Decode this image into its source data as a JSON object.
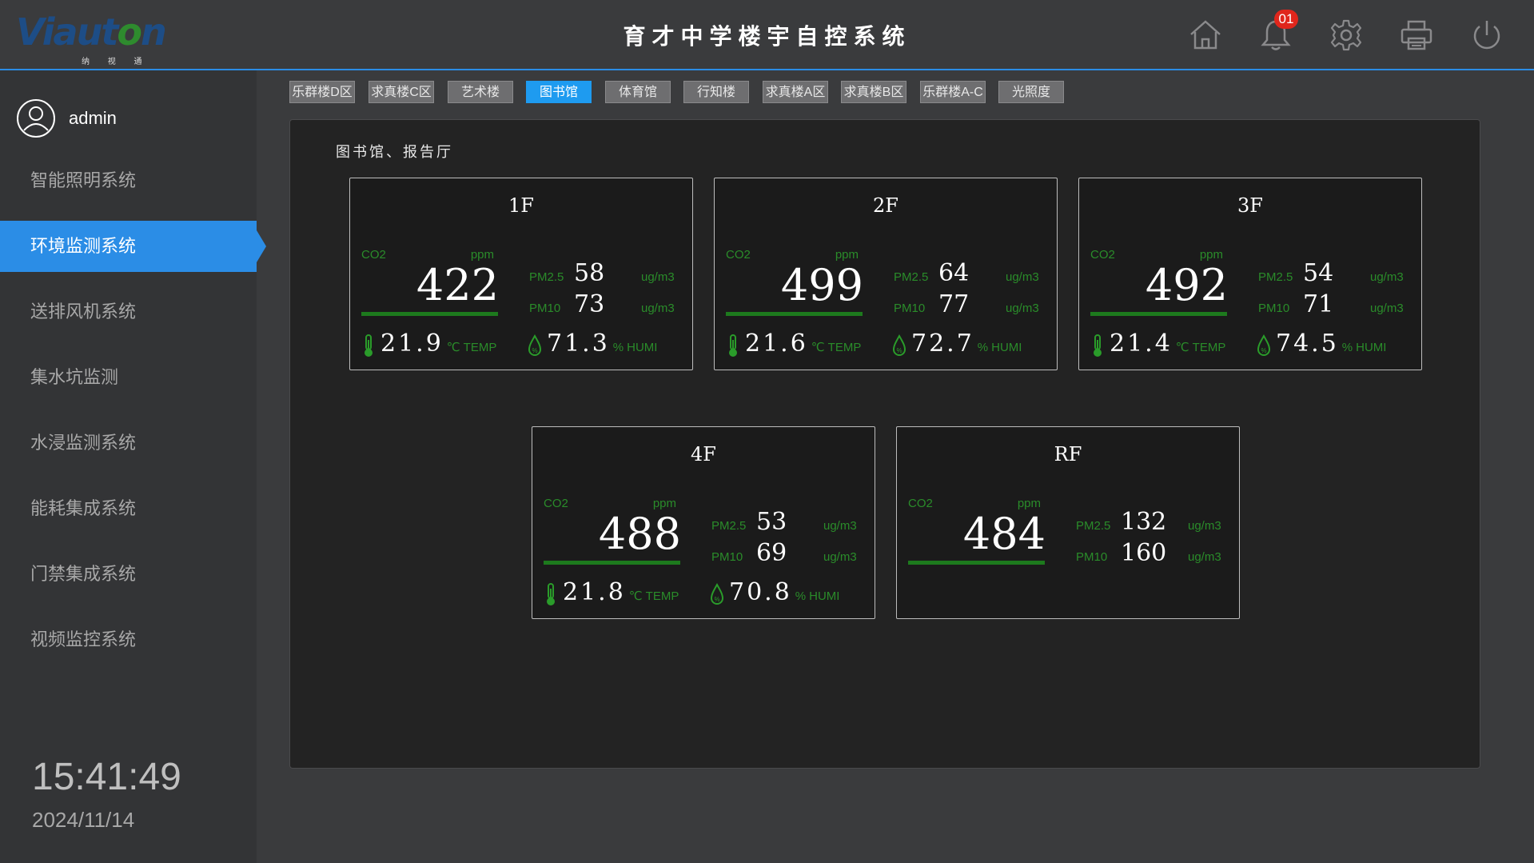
{
  "header": {
    "logo_text": "Viauton",
    "logo_sub": "纳 视 通",
    "title": "育才中学楼宇自控系统",
    "notification_count": "01"
  },
  "sidebar": {
    "user": "admin",
    "items": [
      {
        "label": "智能照明系统"
      },
      {
        "label": "环境监测系统",
        "active": true
      },
      {
        "label": "送排风机系统"
      },
      {
        "label": "集水坑监测"
      },
      {
        "label": "水浸监测系统"
      },
      {
        "label": "能耗集成系统"
      },
      {
        "label": "门禁集成系统"
      },
      {
        "label": "视频监控系统"
      }
    ],
    "time": "15:41:49",
    "date": "2024/11/14"
  },
  "tabs": [
    {
      "label": "乐群楼D区"
    },
    {
      "label": "求真楼C区"
    },
    {
      "label": "艺术楼"
    },
    {
      "label": "图书馆",
      "active": true
    },
    {
      "label": "体育馆"
    },
    {
      "label": "行知楼"
    },
    {
      "label": "求真楼A区"
    },
    {
      "label": "求真楼B区"
    },
    {
      "label": "乐群楼A-C"
    },
    {
      "label": "光照度"
    }
  ],
  "panel": {
    "title": "图书馆、报告厅",
    "labels": {
      "co2": "CO2",
      "ppm": "ppm",
      "pm25": "PM2.5",
      "pm10": "PM10",
      "ugm3": "ug/m3",
      "celsius": "℃",
      "temp": "TEMP",
      "percent": "%",
      "humi": "HUMI"
    },
    "floors": [
      {
        "name": "1F",
        "co2": "422",
        "pm25": "58",
        "pm10": "73",
        "temp": "21.9",
        "humi": "71.3"
      },
      {
        "name": "2F",
        "co2": "499",
        "pm25": "64",
        "pm10": "77",
        "temp": "21.6",
        "humi": "72.7"
      },
      {
        "name": "3F",
        "co2": "492",
        "pm25": "54",
        "pm10": "71",
        "temp": "21.4",
        "humi": "74.5"
      },
      {
        "name": "4F",
        "co2": "488",
        "pm25": "53",
        "pm10": "69",
        "temp": "21.8",
        "humi": "70.8"
      },
      {
        "name": "RF",
        "co2": "484",
        "pm25": "132",
        "pm10": "160"
      }
    ]
  },
  "colors": {
    "accent": "#2b8de6",
    "tab_active": "#1e9bf0",
    "metric_green": "#2a8c2a",
    "badge_red": "#e0261c"
  },
  "icons": [
    "user-avatar-icon",
    "home-icon",
    "bell-icon",
    "gear-icon",
    "printer-icon",
    "power-icon",
    "thermometer-icon",
    "humidity-drop-icon"
  ]
}
